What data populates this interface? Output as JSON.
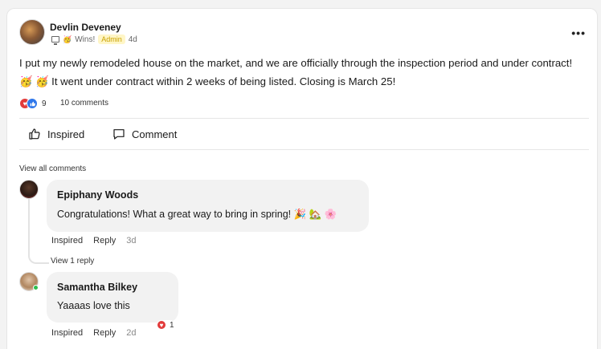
{
  "post": {
    "author": "Devlin Deveney",
    "category": "Wins!",
    "badge": "Admin",
    "time": "4d",
    "more_label": "•••",
    "text": "I put my newly remodeled house on the market, and we are officially through the inspection period and under contract! 🥳 🥳 It went under contract within 2 weeks of being listed. Closing is March 25!",
    "reaction_count": "9",
    "comments_count": "10 comments",
    "actions": {
      "inspired": "Inspired",
      "comment": "Comment"
    }
  },
  "comments": {
    "view_all": "View all comments",
    "items": [
      {
        "name": "Epiphany Woods",
        "text": "Congratulations! What a great way to bring in spring! 🎉 🏡 🌸",
        "inspired": "Inspired",
        "reply": "Reply",
        "time": "3d",
        "view_replies": "View 1 reply"
      },
      {
        "name": "Samantha Bilkey",
        "text": "Yaaaas love this",
        "inspired": "Inspired",
        "reply": "Reply",
        "time": "2d",
        "reaction_count": "1"
      }
    ]
  },
  "icons": {
    "heart": "heart-icon",
    "like": "like-icon",
    "party": "party-icon",
    "monitor": "monitor-icon",
    "thumbs_up": "thumbs-up-icon",
    "speech_bubble": "comment-icon"
  },
  "colors": {
    "admin_badge_bg": "#fff6c7",
    "admin_badge_text": "#c9a100",
    "heart_red": "#e23b3b",
    "like_blue": "#2f77ea",
    "online_green": "#2fbf4f",
    "bubble_bg": "#f2f2f2"
  }
}
